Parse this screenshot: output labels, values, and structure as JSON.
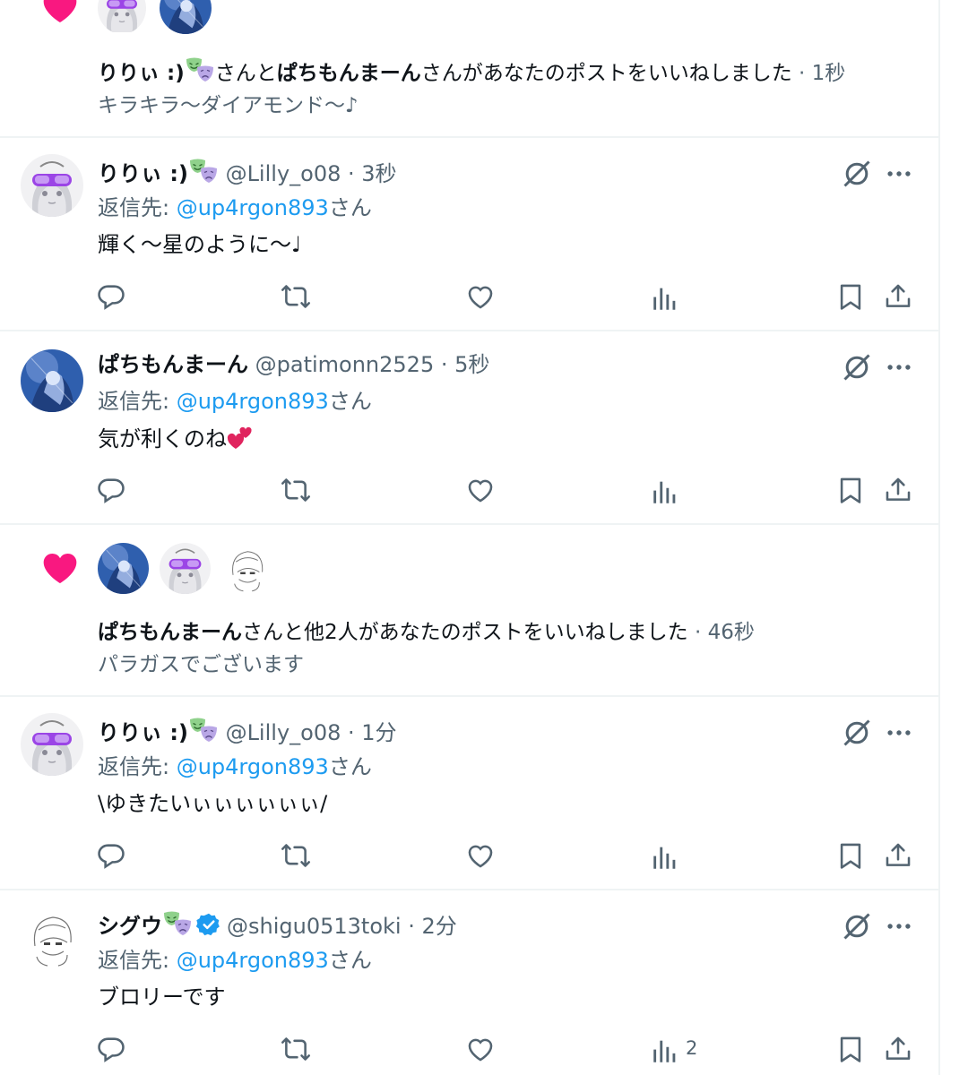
{
  "notifications": [
    {
      "liker_1": "りりぃ :)",
      "connector": "さんと",
      "liker_2": "ぱちもんまーん",
      "action_text": "さんがあなたのポストをいいねしました",
      "time": "· 1秒",
      "post_preview": "キラキラ〜ダイアモンド〜♪"
    },
    {
      "liker_1": "ぱちもんまーん",
      "action_text": "さんと他2人があなたのポストをいいねしました",
      "time": "· 46秒",
      "post_preview": "パラガスでございます"
    }
  ],
  "tweets": [
    {
      "name": "りりぃ :)",
      "handle": "@Lilly_o08",
      "time": "· 3秒",
      "reply_prefix": "返信先: ",
      "reply_to": "@up4rgon893",
      "reply_suffix": "さん",
      "text": "輝く〜星のように〜♩",
      "views": ""
    },
    {
      "name": "ぱちもんまーん",
      "handle": "@patimonn2525",
      "time": "· 5秒",
      "reply_prefix": "返信先: ",
      "reply_to": "@up4rgon893",
      "reply_suffix": "さん",
      "text": "気が利くのね",
      "views": ""
    },
    {
      "name": "りりぃ :)",
      "handle": "@Lilly_o08",
      "time": "· 1分",
      "reply_prefix": "返信先: ",
      "reply_to": "@up4rgon893",
      "reply_suffix": "さん",
      "text": "\\ゆきたいぃぃぃぃぃぃ/",
      "views": ""
    },
    {
      "name": "シグウ",
      "handle": "@shigu0513toki",
      "time": "· 2分",
      "reply_prefix": "返信先: ",
      "reply_to": "@up4rgon893",
      "reply_suffix": "さん",
      "text": "ブロリーです",
      "views": "2"
    }
  ],
  "icons": {
    "like": "heart-icon",
    "reply": "reply-icon",
    "repost": "repost-icon",
    "views": "views-icon",
    "bookmark": "bookmark-icon",
    "share": "share-icon",
    "grok": "grok-icon",
    "more": "more-icon",
    "verified": "verified-badge-icon",
    "mask_emoji": "performing-arts-icon"
  },
  "colors": {
    "text": "#0f1419",
    "muted": "#536471",
    "link": "#1d9bf0",
    "like_pink": "#f91880",
    "divider": "#eff3f4",
    "mask_green": "#8fd18b",
    "mask_purple": "#b9a7e6"
  }
}
